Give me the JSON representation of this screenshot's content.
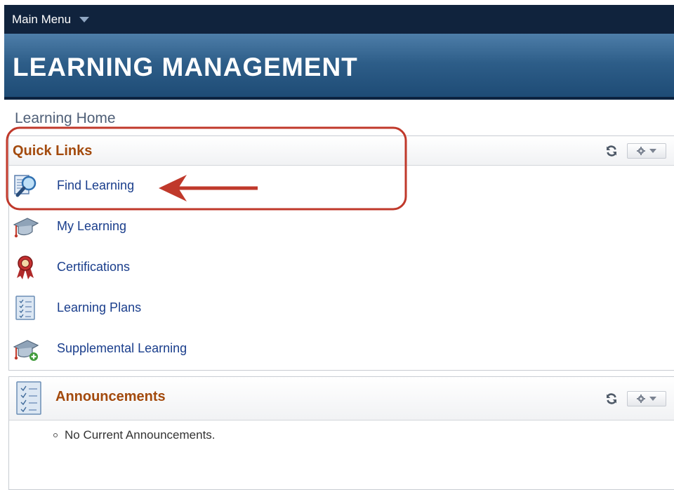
{
  "topbar": {
    "menu_label": "Main Menu",
    "menu_icon": "chevron-down-icon"
  },
  "banner": {
    "title": "LEARNING MANAGEMENT"
  },
  "breadcrumb": "Learning Home",
  "quick_links": {
    "title": "Quick Links",
    "items": [
      {
        "label": "Find Learning",
        "icon": "magnifier-document-icon"
      },
      {
        "label": "My Learning",
        "icon": "graduation-cap-icon"
      },
      {
        "label": "Certifications",
        "icon": "award-ribbon-icon"
      },
      {
        "label": "Learning Plans",
        "icon": "checklist-icon"
      },
      {
        "label": "Supplemental Learning",
        "icon": "graduation-cap-plus-icon"
      }
    ]
  },
  "announcements": {
    "title": "Announcements",
    "items": [
      "No Current Announcements."
    ]
  },
  "colors": {
    "accent_orange": "#a34a0d",
    "link_blue": "#1a3e8c",
    "nav_dark": "#10233d",
    "annotation_red": "#c0392b"
  }
}
